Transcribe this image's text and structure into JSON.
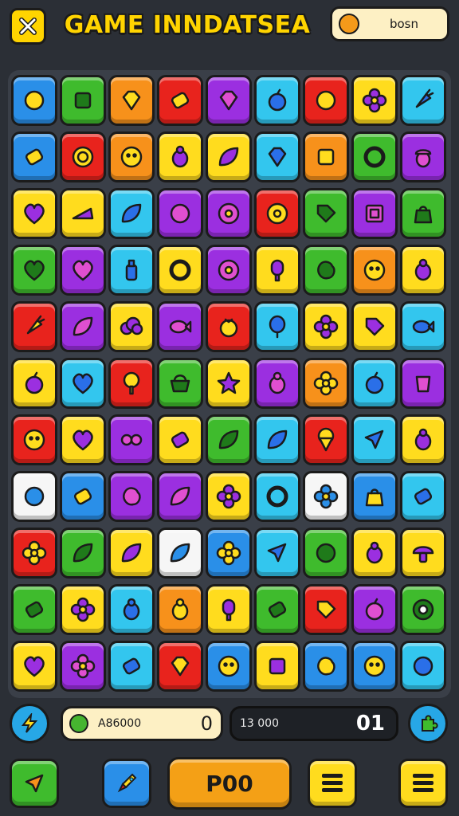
{
  "header": {
    "title": "GAME INNDATSEA",
    "coin_label": "bosn",
    "close_icon": "close-x-icon",
    "coin_icon": "coin-icon"
  },
  "colors": {
    "B": "#2a8fe8",
    "G": "#3fbb2d",
    "O": "#f7911b",
    "R": "#e8231d",
    "P": "#9b2fe0",
    "C": "#33c6ee",
    "Y": "#ffdc1e",
    "W": "#f6f6f6"
  },
  "board": {
    "rows": [
      [
        "B",
        "G",
        "O",
        "R",
        "P",
        "C",
        "R",
        "Y",
        "C"
      ],
      [
        "B",
        "R",
        "O",
        "Y",
        "Y",
        "C",
        "O",
        "G",
        "P"
      ],
      [
        "Y",
        "Y",
        "C",
        "P",
        "P",
        "R",
        "G",
        "P",
        "G"
      ],
      [
        "G",
        "P",
        "C",
        "Y",
        "P",
        "Y",
        "G",
        "O",
        "Y"
      ],
      [
        "R",
        "P",
        "Y",
        "P",
        "R",
        "C",
        "Y",
        "Y",
        "C"
      ],
      [
        "Y",
        "C",
        "R",
        "G",
        "Y",
        "P",
        "O",
        "C",
        "P"
      ],
      [
        "R",
        "Y",
        "P",
        "Y",
        "G",
        "C",
        "R",
        "C",
        "Y"
      ],
      [
        "W",
        "B",
        "P",
        "P",
        "Y",
        "C",
        "W",
        "B",
        "C"
      ],
      [
        "R",
        "G",
        "Y",
        "W",
        "B",
        "C",
        "G",
        "Y",
        "Y"
      ],
      [
        "G",
        "Y",
        "C",
        "O",
        "Y",
        "G",
        "R",
        "P",
        "G"
      ],
      [
        "Y",
        "P",
        "C",
        "R",
        "B",
        "Y",
        "B",
        "B",
        "C"
      ]
    ],
    "icons": [
      [
        "gift-icon",
        "box-icon",
        "gem-icon",
        "candy-icon",
        "gem-icon",
        "apple-icon",
        "orb-icon",
        "flower-icon",
        "carrot-icon"
      ],
      [
        "candy-icon",
        "coin-icon",
        "face-icon",
        "bug-icon",
        "leaf-icon",
        "gem-icon",
        "box-icon",
        "ring-icon",
        "acorn-icon"
      ],
      [
        "heart-icon",
        "cheese-icon",
        "leaf-icon",
        "shoe-icon",
        "donut-icon",
        "donut-icon",
        "tag-icon",
        "frame-icon",
        "bag-icon"
      ],
      [
        "heart-icon",
        "heart-icon",
        "bottle-icon",
        "ring-icon",
        "donut-icon",
        "popsicle-icon",
        "blob-icon",
        "face-icon",
        "bug-icon"
      ],
      [
        "carrot-icon",
        "leaf-icon",
        "cloud-icon",
        "fish-icon",
        "berry-icon",
        "balloon-icon",
        "flower-icon",
        "tag-icon",
        "fish-icon"
      ],
      [
        "apple-icon",
        "heart-icon",
        "lollipop-icon",
        "basket-icon",
        "star-icon",
        "bug-icon",
        "flower-icon",
        "apple-icon",
        "cup-icon"
      ],
      [
        "face-icon",
        "heart-icon",
        "glasses-icon",
        "candy-icon",
        "leaf-icon",
        "leaf-icon",
        "ice-cream-icon",
        "arrow-icon",
        "bug-icon"
      ],
      [
        "orb-icon",
        "candy-icon",
        "blob-icon",
        "leaf-icon",
        "flower-icon",
        "ring-icon",
        "flower-icon",
        "bag-icon",
        "candy-icon"
      ],
      [
        "flower-icon",
        "leaf-icon",
        "leaf-icon",
        "leaf-icon",
        "flower-icon",
        "arrow-icon",
        "orb-icon",
        "bug-icon",
        "mushroom-icon"
      ],
      [
        "candy-icon",
        "flower-icon",
        "bug-icon",
        "bug-icon",
        "popsicle-icon",
        "candy-icon",
        "tag-icon",
        "apple-icon",
        "wheel-icon"
      ],
      [
        "heart-icon",
        "flower-icon",
        "candy-icon",
        "gem-icon",
        "face-icon",
        "box-icon",
        "blob-icon",
        "face-icon",
        "orb-icon"
      ]
    ]
  },
  "footer": {
    "score_label": "A86000",
    "score_value": "0",
    "moves_label": "13 000",
    "moves_value": "01",
    "play_label": "P00",
    "left_round_icon": "lightning-icon",
    "right_round_icon": "puzzle-icon",
    "arrow_button_icon": "arrow-icon",
    "rocket_button_icon": "rocket-icon",
    "menu_button_icon": "menu-icon"
  }
}
